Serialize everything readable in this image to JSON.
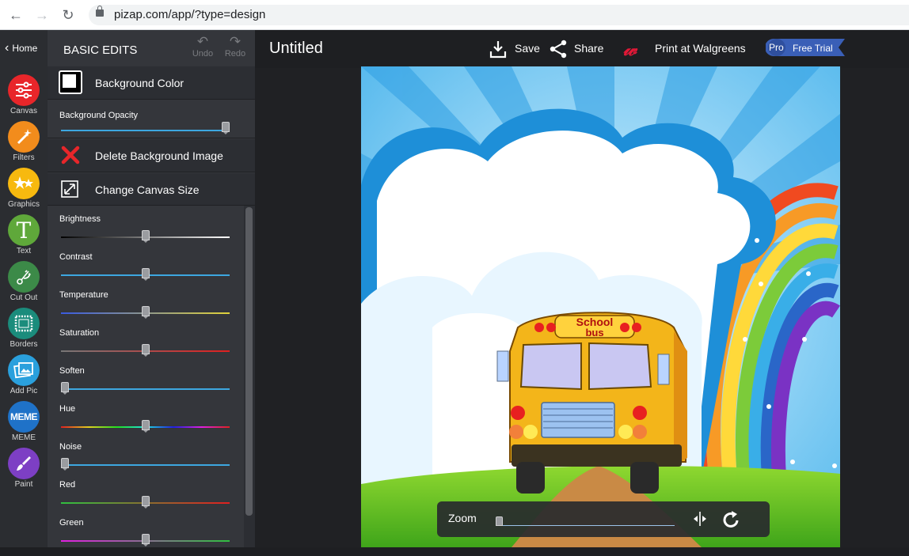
{
  "browser": {
    "url": "pizap.com/app/?type=design"
  },
  "rail": {
    "home_label": "Home",
    "tools": [
      {
        "label": "Canvas",
        "color": "#e8262a"
      },
      {
        "label": "Filters",
        "color": "#f28c1c"
      },
      {
        "label": "Graphics",
        "color": "#f7b90f"
      },
      {
        "label": "Text",
        "color": "#5fa83a"
      },
      {
        "label": "Cut Out",
        "color": "#3c8a48"
      },
      {
        "label": "Borders",
        "color": "#1b8c7c"
      },
      {
        "label": "Add Pic",
        "color": "#2aa0dd"
      },
      {
        "label": "MEME",
        "color": "#1f72c8"
      },
      {
        "label": "Paint",
        "color": "#7d3fc4"
      }
    ],
    "icon_names": [
      "sliders-icon",
      "magic-wand-icon",
      "stars-icon",
      "text-T-icon",
      "scissors-icon",
      "frame-icon",
      "add-picture-icon",
      "meme-icon",
      "paint-brush-icon"
    ],
    "meme_icon_text": "MEME",
    "text_icon_glyph": "T"
  },
  "panel": {
    "title": "BASIC EDITS",
    "undo_label": "Undo",
    "redo_label": "Redo",
    "background_color_label": "Background Color",
    "background_opacity_label": "Background Opacity",
    "background_opacity_value": 1.0,
    "delete_bg_label": "Delete Background Image",
    "change_canvas_label": "Change Canvas Size",
    "sliders": [
      {
        "label": "Brightness",
        "value": 0.5
      },
      {
        "label": "Contrast",
        "value": 0.5
      },
      {
        "label": "Temperature",
        "value": 0.5
      },
      {
        "label": "Saturation",
        "value": 0.5
      },
      {
        "label": "Soften",
        "value": 0.0
      },
      {
        "label": "Hue",
        "value": 0.5
      },
      {
        "label": "Noise",
        "value": 0.0
      },
      {
        "label": "Red",
        "value": 0.5
      },
      {
        "label": "Green",
        "value": 0.5
      }
    ]
  },
  "toolbar": {
    "doc_title": "Untitled",
    "save_label": "Save",
    "share_label": "Share",
    "print_label": "Print at Walgreens",
    "pro_label": "Pro",
    "trial_label": "Free Trial"
  },
  "canvas_image": {
    "bus_text_line1": "School",
    "bus_text_line2": "bus"
  },
  "zoom": {
    "label": "Zoom",
    "value": 0.0
  },
  "colors": {
    "accent_blue": "#3da7e0",
    "walgreens_red": "#e31837",
    "pro_badge": "#3a5fb7"
  }
}
